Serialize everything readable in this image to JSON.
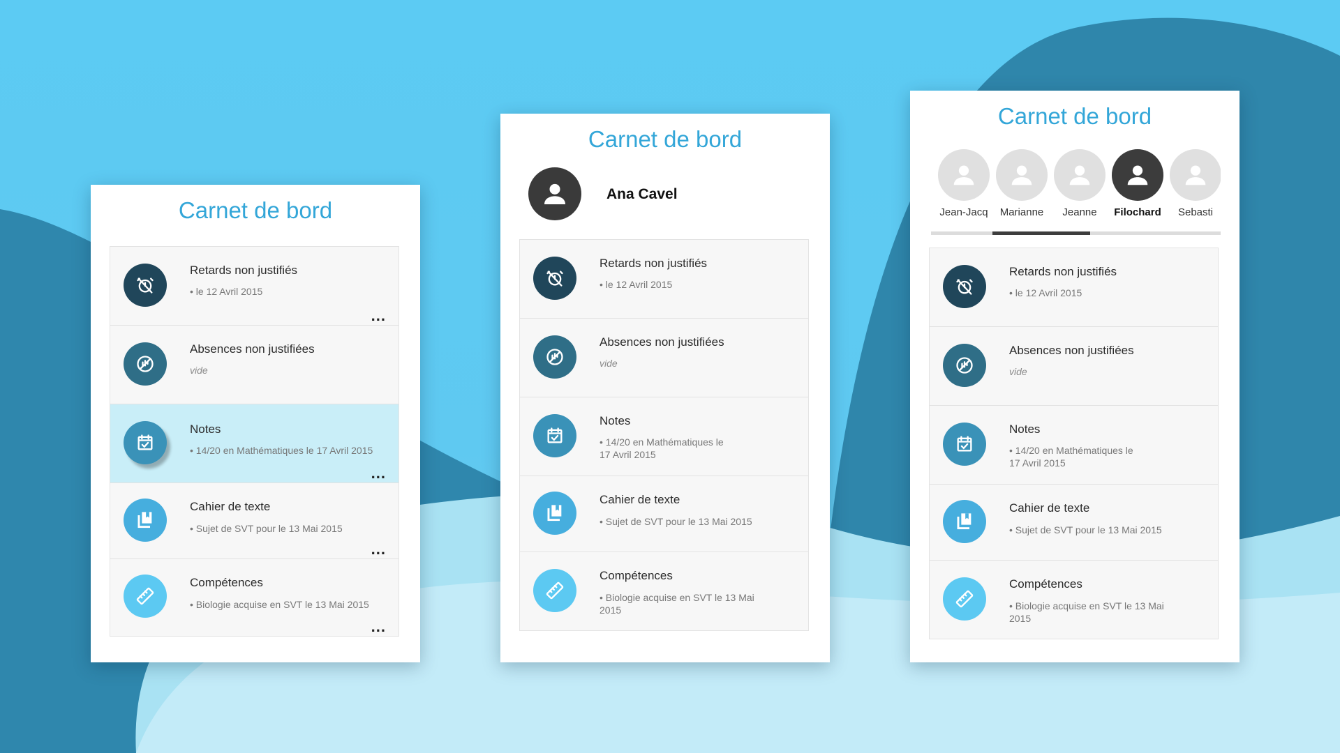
{
  "colors": {
    "sky": "#5ccbf3",
    "c1": "#20465a",
    "c2": "#2f6e87",
    "c3": "#3a92b8",
    "c4": "#46aede",
    "c5": "#5cc9f2",
    "selected": "#c9eef8",
    "title": "#33a6d8"
  },
  "screens": [
    {
      "title": "Carnet de bord",
      "items": [
        {
          "icon": "alarm-off-icon",
          "title": "Retards non justifiés",
          "sub": "• le 12 Avril 2015",
          "empty": false,
          "more": "..."
        },
        {
          "icon": "hand-blocked-icon",
          "title": "Absences non justifiées",
          "sub": "vide",
          "empty": true,
          "more": ""
        },
        {
          "icon": "calendar-check-icon",
          "title": "Notes",
          "sub": "• 14/20 en Mathématiques le 17 Avril 2015",
          "empty": false,
          "more": "..."
        },
        {
          "icon": "book-stack-icon",
          "title": "Cahier de texte",
          "sub": "• Sujet de SVT pour le 13 Mai 2015",
          "empty": false,
          "more": "..."
        },
        {
          "icon": "ruler-icon",
          "title": "Compétences",
          "sub": "• Biologie acquise en SVT le 13 Mai 2015",
          "empty": false,
          "more": "..."
        }
      ]
    },
    {
      "title": "Carnet de bord",
      "profile": {
        "name": "Ana Cavel"
      },
      "items": [
        {
          "icon": "alarm-off-icon",
          "title": "Retards non justifiés",
          "sub": "• le 12 Avril 2015",
          "empty": false
        },
        {
          "icon": "hand-blocked-icon",
          "title": "Absences non justifiées",
          "sub": "vide",
          "empty": true
        },
        {
          "icon": "calendar-check-icon",
          "title": "Notes",
          "sub": "• 14/20 en Mathématiques le\n17 Avril 2015",
          "empty": false
        },
        {
          "icon": "book-stack-icon",
          "title": "Cahier de texte",
          "sub": "• Sujet de SVT pour le 13 Mai 2015",
          "empty": false
        },
        {
          "icon": "ruler-icon",
          "title": "Compétences",
          "sub": "• Biologie acquise en SVT le 13 Mai\n2015",
          "empty": false
        }
      ]
    },
    {
      "title": "Carnet de bord",
      "children": [
        {
          "name": "Jean-Jacq",
          "active": false
        },
        {
          "name": "Marianne",
          "active": false
        },
        {
          "name": "Jeanne",
          "active": false
        },
        {
          "name": "Filochard",
          "active": true
        },
        {
          "name": "Sebasti",
          "active": false
        }
      ],
      "items": [
        {
          "icon": "alarm-off-icon",
          "title": "Retards non justifiés",
          "sub": "• le 12 Avril 2015",
          "empty": false
        },
        {
          "icon": "hand-blocked-icon",
          "title": "Absences non justifiées",
          "sub": "vide",
          "empty": true
        },
        {
          "icon": "calendar-check-icon",
          "title": "Notes",
          "sub": "• 14/20 en Mathématiques le\n17 Avril 2015",
          "empty": false
        },
        {
          "icon": "book-stack-icon",
          "title": "Cahier de texte",
          "sub": "• Sujet de SVT pour le 13 Mai 2015",
          "empty": false
        },
        {
          "icon": "ruler-icon",
          "title": "Compétences",
          "sub": "• Biologie acquise en SVT le 13 Mai\n2015",
          "empty": false
        }
      ]
    }
  ]
}
